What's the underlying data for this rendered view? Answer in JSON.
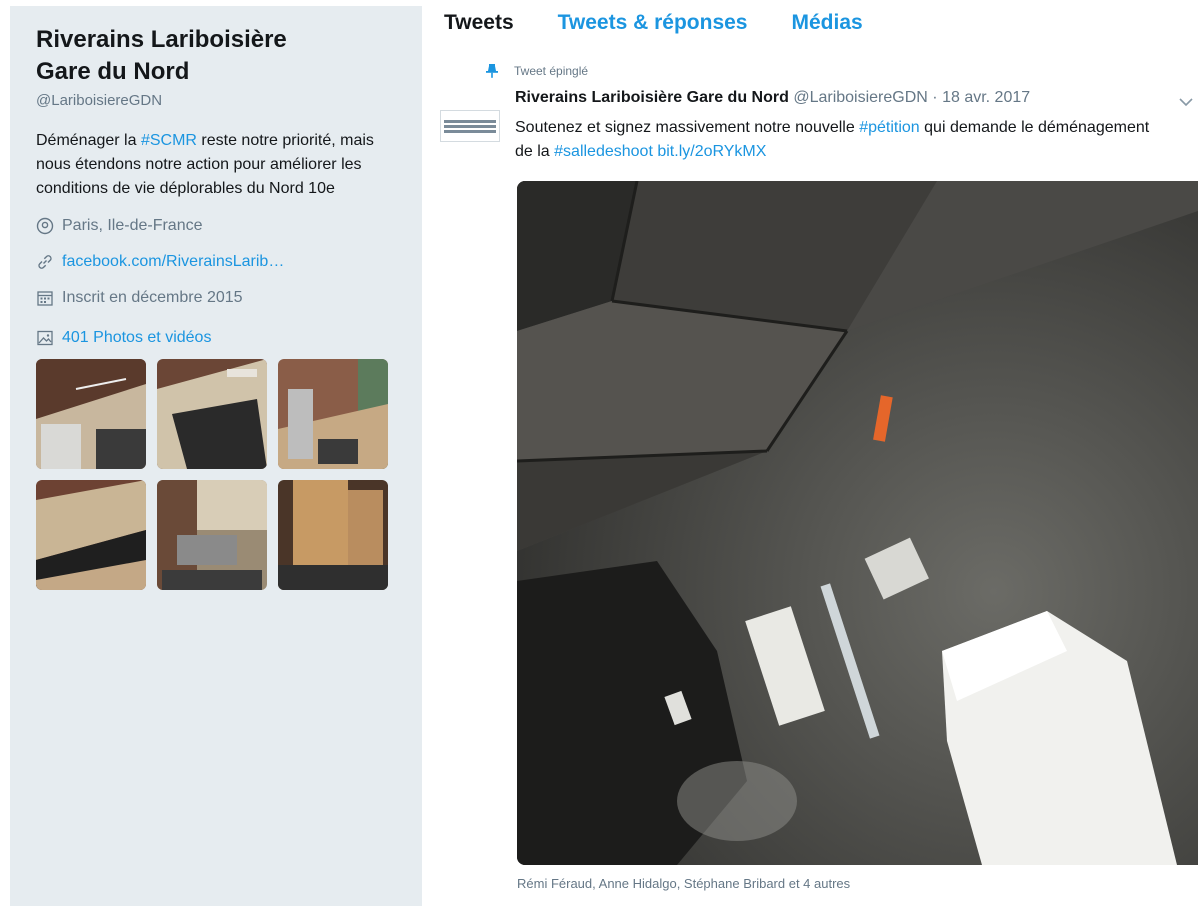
{
  "profile": {
    "name_line1": "Riverains Lariboisière",
    "name_line2": "Gare du Nord",
    "handle": "@LariboisiereGDN",
    "bio_before": "Déménager la ",
    "bio_hashtag": "#SCMR",
    "bio_after": " reste notre priorité, mais nous étendons notre action pour améliorer les conditions de vie déplorables du Nord 10e",
    "location": "Paris, Ile-de-France",
    "website": "facebook.com/RiverainsLarib…",
    "joined": "Inscrit en décembre 2015",
    "photos_label": "401 Photos et vidéos",
    "location_icon": "location-pin-icon",
    "link_icon": "link-icon",
    "calendar_icon": "calendar-icon",
    "photos_icon": "photo-icon"
  },
  "tabs": [
    {
      "label": "Tweets",
      "active": true
    },
    {
      "label": "Tweets & réponses",
      "active": false
    },
    {
      "label": "Médias",
      "active": false
    }
  ],
  "tweet": {
    "pinned_label": "Tweet épinglé",
    "author": "Riverains Lariboisière Gare du Nord",
    "handle": "@LariboisiereGDN",
    "separator": "·",
    "date": "18 avr. 2017",
    "text_part1": "Soutenez et signez massivement notre nouvelle ",
    "hashtag1": "#pétition",
    "text_part2": " qui demande le déménagement de la ",
    "hashtag2": "#salledeshoot",
    "text_part3": "  ",
    "link": "bit.ly/2oRYkMX",
    "tagged": "Rémi Féraud, Anne Hidalgo, Stéphane Bribard et 4 autres"
  },
  "colors": {
    "accent": "#1b95e0",
    "sidebar_bg": "#e6ecf0",
    "text": "#14171a",
    "muted": "#657786"
  }
}
